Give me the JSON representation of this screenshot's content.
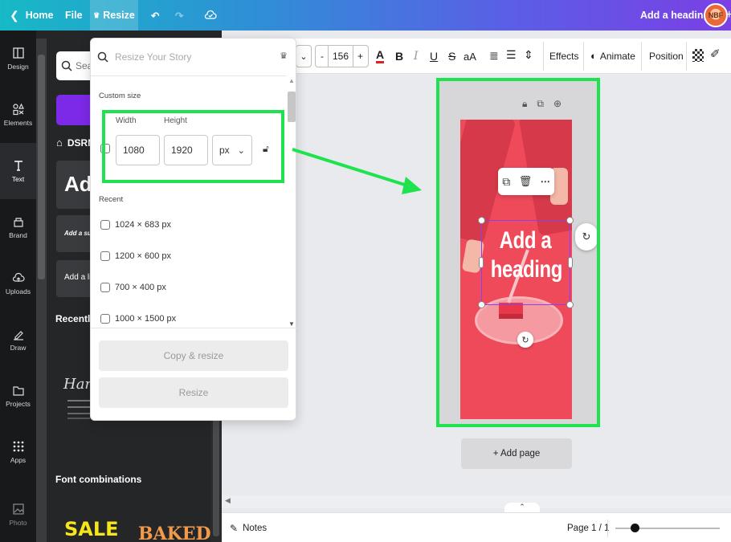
{
  "topbar": {
    "home_label": "Home",
    "file_label": "File",
    "resize_label": "Resize",
    "doc_title": "Add a heading",
    "avatar_text": "NBF"
  },
  "rail": {
    "items": [
      {
        "label": "Design",
        "icon": "design-icon"
      },
      {
        "label": "Elements",
        "icon": "elements-icon"
      },
      {
        "label": "Text",
        "icon": "text-icon"
      },
      {
        "label": "Brand",
        "icon": "brand-icon"
      },
      {
        "label": "Uploads",
        "icon": "uploads-icon"
      },
      {
        "label": "Draw",
        "icon": "draw-icon"
      },
      {
        "label": "Projects",
        "icon": "projects-icon"
      },
      {
        "label": "Apps",
        "icon": "apps-icon"
      },
      {
        "label": "Photo",
        "icon": "photo-icon"
      }
    ],
    "active": "Text"
  },
  "side_panel": {
    "search_placeholder": "Sear",
    "brand_label": "DSRM",
    "card_heading": "Add a",
    "card_subheading": "Add a subh",
    "card_body": "Add a littl",
    "recently_used": "Recently u",
    "handwritten_sample": "Hand",
    "font_combinations": "Font combinations",
    "sample_sale": "SALE",
    "sample_baked": "BAKED"
  },
  "editor_toolbar": {
    "font_size": "156",
    "minus": "-",
    "plus": "+",
    "effects_label": "Effects",
    "animate_label": "Animate",
    "position_label": "Position",
    "text_color_glyph": "A",
    "bold_glyph": "B",
    "italic_glyph": "I",
    "underline_glyph": "U",
    "strike_glyph": "S",
    "case_glyph": "aA"
  },
  "resize_popup": {
    "search_placeholder": "Resize Your Story",
    "custom_size_label": "Custom size",
    "width_label": "Width",
    "height_label": "Height",
    "width_value": "1080",
    "height_value": "1920",
    "unit_value": "px",
    "recent_label": "Recent",
    "recent_items": [
      "1024 × 683 px",
      "1200 × 600 px",
      "700 × 400 px",
      "1000 × 1500 px"
    ],
    "copy_resize_label": "Copy & resize",
    "resize_label": "Resize"
  },
  "canvas": {
    "heading_line1": "Add a",
    "heading_line2": "heading",
    "add_page_label": "+ Add page",
    "float_more": "⋯"
  },
  "bottombar": {
    "notes_label": "Notes",
    "page_indicator": "Page 1 / 1"
  },
  "colors": {
    "highlight_green": "#1fe34e",
    "design_background": "#ef4a5a",
    "selection_purple": "#8a3ff2",
    "topbar_gradient_start": "#17b9c6",
    "topbar_gradient_end": "#7b3fe4"
  }
}
